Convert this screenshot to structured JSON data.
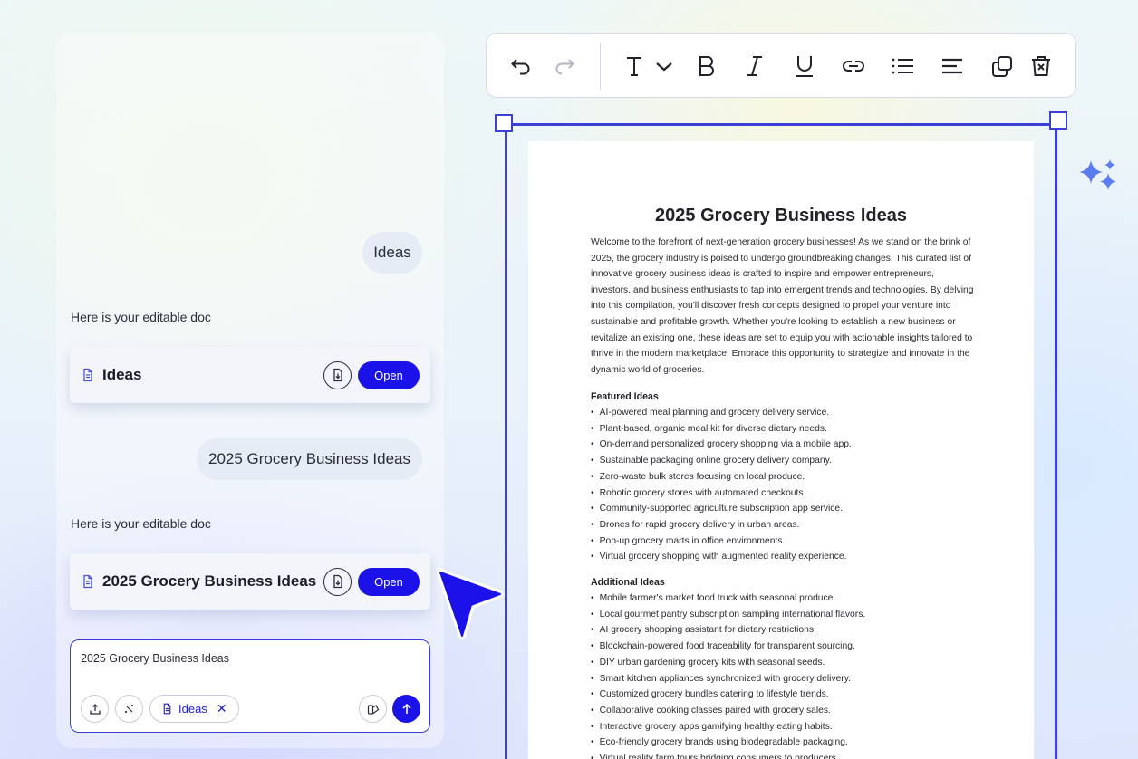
{
  "chat": {
    "messages": [
      {
        "role": "user",
        "text": "Ideas"
      },
      {
        "role": "assistant",
        "text": "Here is your editable doc",
        "doc_title": "Ideas",
        "open_label": "Open"
      },
      {
        "role": "user",
        "text": "2025 Grocery Business Ideas"
      },
      {
        "role": "assistant",
        "text": "Here is your editable doc",
        "doc_title": "2025 Grocery Business Ideas",
        "open_label": "Open"
      }
    ],
    "input": {
      "value": "2025 Grocery Business Ideas",
      "chip_label": "Ideas",
      "chip_close": "✕"
    }
  },
  "toolbar": {
    "items": [
      "undo-icon",
      "redo-icon",
      "text-style-icon",
      "chevron-down-icon",
      "bold-icon",
      "italic-icon",
      "underline-icon",
      "link-icon",
      "bullet-list-icon",
      "align-left-icon",
      "duplicate-icon",
      "delete-icon"
    ]
  },
  "document": {
    "title": "2025 Grocery Business Ideas",
    "intro": "Welcome to the forefront of next-generation grocery businesses! As we stand on the brink of 2025, the grocery industry is poised to undergo groundbreaking changes. This curated list of innovative grocery business ideas is crafted to inspire and empower entrepreneurs, investors, and business enthusiasts to tap into emergent trends and technologies. By delving into this compilation, you'll discover fresh concepts designed to propel your venture into sustainable and profitable growth. Whether you're looking to establish a new business or revitalize an existing one, these ideas are set to equip you with actionable insights tailored to thrive in the modern marketplace. Embrace this opportunity to strategize and innovate in the dynamic world of groceries.",
    "sections": [
      {
        "heading": "Featured Ideas",
        "items": [
          "AI-powered meal planning and grocery delivery service.",
          "Plant-based, organic meal kit for diverse dietary needs.",
          "On-demand personalized grocery shopping via a mobile app.",
          "Sustainable packaging online grocery delivery company.",
          "Zero-waste bulk stores focusing on local produce.",
          "Robotic grocery stores with automated checkouts.",
          "Community-supported agriculture subscription app service.",
          "Drones for rapid grocery delivery in urban areas.",
          "Pop-up grocery marts in office environments.",
          "Virtual grocery shopping with augmented reality experience."
        ]
      },
      {
        "heading": "Additional Ideas",
        "items": [
          "Mobile farmer's market food truck with seasonal produce.",
          "Local gourmet pantry subscription sampling international flavors.",
          "AI grocery shopping assistant for dietary restrictions.",
          "Blockchain-powered food traceability for transparent sourcing.",
          "DIY urban gardening grocery kits with seasonal seeds.",
          "Smart kitchen appliances synchronized with grocery delivery.",
          "Customized grocery bundles catering to lifestyle trends.",
          "Collaborative cooking classes paired with grocery sales.",
          "Interactive grocery apps gamifying healthy eating habits.",
          "Eco-friendly grocery brands using biodegradable packaging.",
          "Virtual reality farm tours bridging consumers to producers."
        ]
      }
    ]
  },
  "colors": {
    "accent": "#1a12e8",
    "frame": "#3b3fd6",
    "bubble": "#e6ecf5",
    "sparkle": "#5b7cf0"
  }
}
